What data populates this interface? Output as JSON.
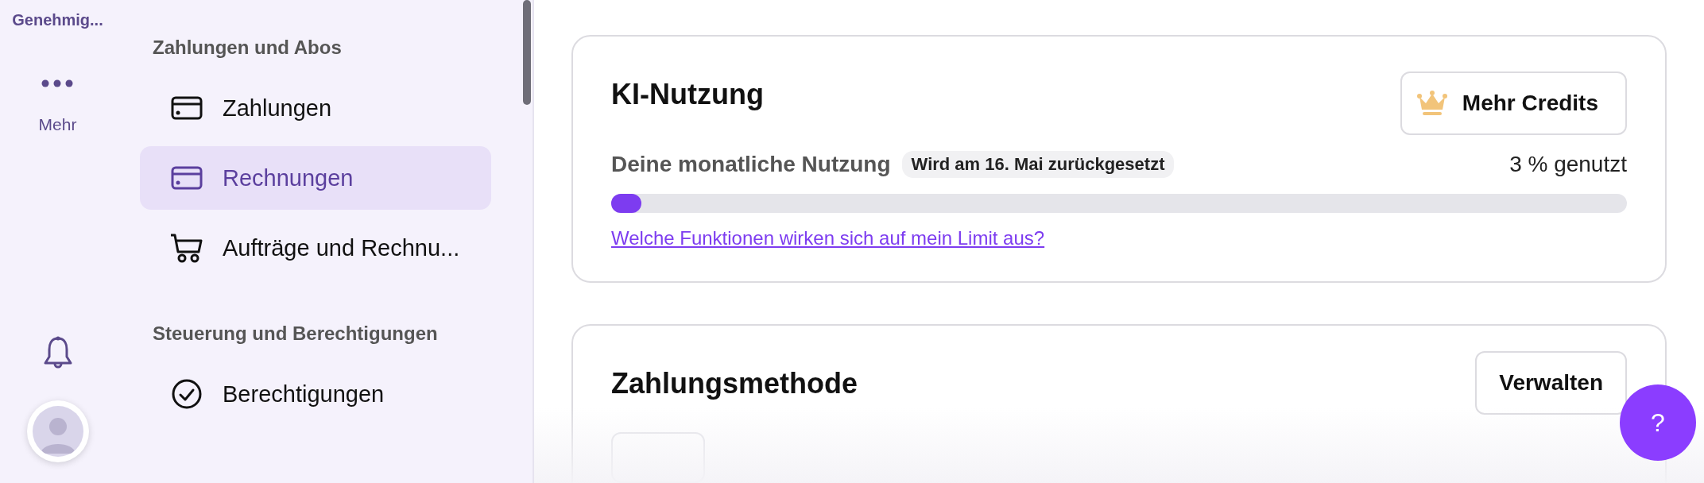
{
  "rail": {
    "top_label": "Genehmig...",
    "more_label": "Mehr"
  },
  "sidebar": {
    "sections": [
      {
        "heading": "Zahlungen und Abos",
        "items": [
          {
            "label": "Zahlungen",
            "kind": "card",
            "selected": false
          },
          {
            "label": "Rechnungen",
            "kind": "card",
            "selected": true
          },
          {
            "label": "Aufträge und Rechnu...",
            "kind": "cart",
            "selected": false
          }
        ]
      },
      {
        "heading": "Steuerung und Berechtigungen",
        "items": [
          {
            "label": "Berechtigungen",
            "kind": "check",
            "selected": false
          }
        ]
      }
    ]
  },
  "usage_card": {
    "title": "KI-Nutzung",
    "button": "Mehr Credits",
    "usage_label": "Deine monatliche Nutzung",
    "reset_badge": "Wird am 16. Mai zurückgesetzt",
    "reading": "3 % genutzt",
    "level": 0.03,
    "link": "Welche Funktionen wirken sich auf mein Limit aus?"
  },
  "payment_card": {
    "title": "Zahlungsmethode",
    "button": "Verwalten"
  },
  "help_button": "?"
}
